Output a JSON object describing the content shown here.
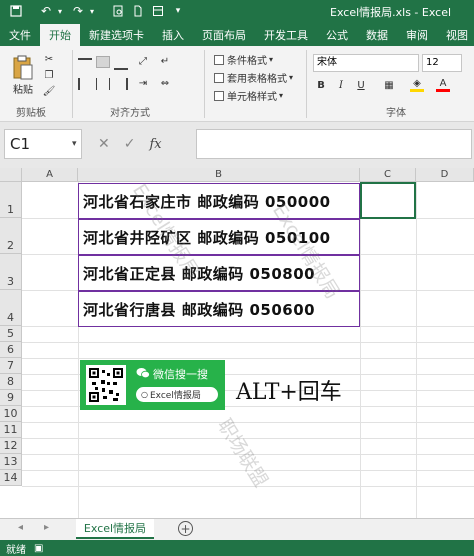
{
  "window": {
    "title": "Excel情报局.xls - Excel"
  },
  "ribbon_tabs": [
    "文件",
    "开始",
    "新建选项卡",
    "插入",
    "页面布局",
    "开发工具",
    "公式",
    "数据",
    "审阅",
    "视图"
  ],
  "ribbon": {
    "paste_label": "粘贴",
    "clipboard_label": "剪贴板",
    "alignment_label": "对齐方式",
    "conditional_format": "条件格式",
    "table_format": "套用表格格式",
    "cell_styles": "单元格样式",
    "font_label": "字体",
    "font_name": "宋体",
    "font_size": "12"
  },
  "formula_bar": {
    "name_box": "C1",
    "fx": "fx",
    "formula": ""
  },
  "columns": [
    "A",
    "B",
    "C",
    "D"
  ],
  "rows": [
    "1",
    "2",
    "3",
    "4",
    "5",
    "6",
    "7",
    "8",
    "9",
    "10",
    "11",
    "12",
    "13",
    "14"
  ],
  "cells": [
    "河北省石家庄市 邮政编码 050000",
    "河北省井陉矿区 邮政编码 050100",
    "河北省正定县 邮政编码 050800",
    "河北省行唐县 邮政编码 050600"
  ],
  "annotation": "ALT+回车",
  "wechat": {
    "search_text": "微信搜一搜",
    "pill_text": "Excel情报局"
  },
  "watermarks": [
    "Excel情报局",
    "Excel情报局",
    "职场联盟"
  ],
  "sheet_tab": "Excel情报局",
  "status": {
    "ready": "就绪"
  },
  "colors": {
    "excel_green": "#217346",
    "cell_border": "#7030a0",
    "wechat_green": "#27b24a"
  }
}
